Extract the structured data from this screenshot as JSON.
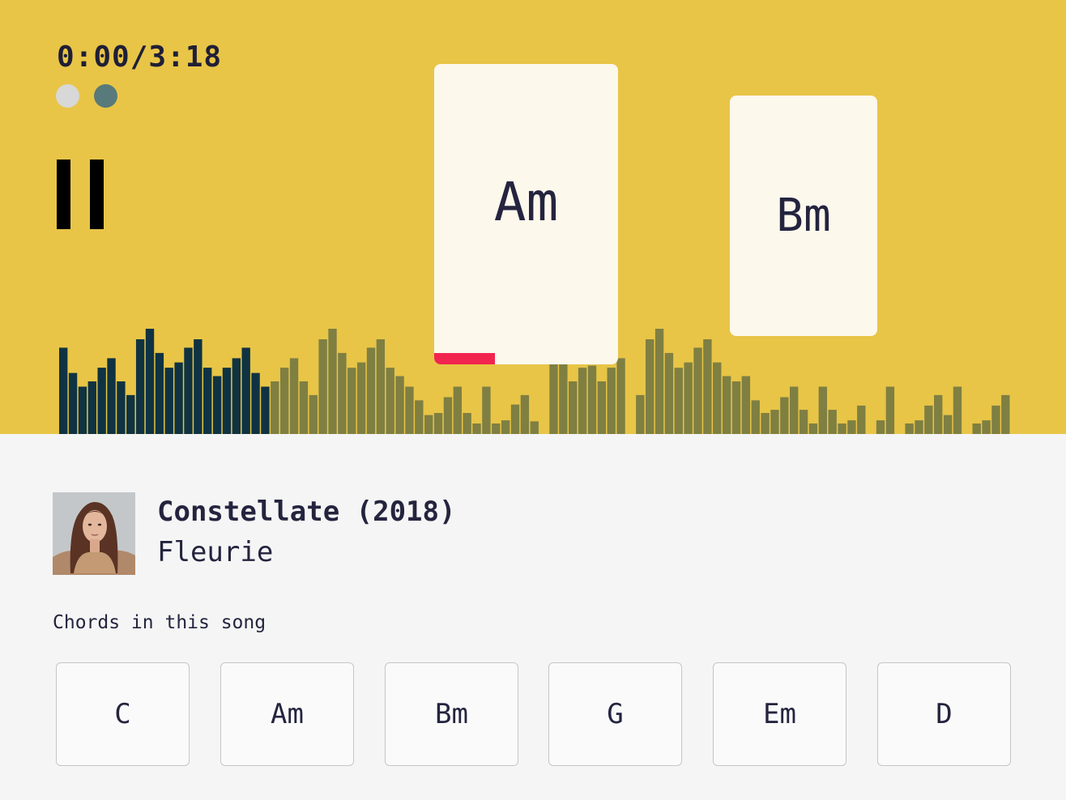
{
  "player": {
    "time": "0:00/3:18",
    "progress_fraction": 0,
    "background_color": "#e8c547",
    "pause_icon": "pause-icon",
    "dots": [
      {
        "name": "dot-inactive",
        "color": "#d8d8d8"
      },
      {
        "name": "dot-active",
        "color": "#587a7a"
      }
    ],
    "current_chord": {
      "label": "Am",
      "progress_fraction": 0.33,
      "progress_color": "#f2254f"
    },
    "next_chord": {
      "label": "Bm"
    },
    "waveform": {
      "played_color": "#0f3342",
      "unplayed_color": "#7f7f42",
      "played_bars": 22,
      "levels": [
        0.82,
        0.58,
        0.45,
        0.5,
        0.63,
        0.72,
        0.5,
        0.37,
        0.9,
        1.0,
        0.77,
        0.63,
        0.68,
        0.82,
        0.9,
        0.63,
        0.55,
        0.63,
        0.72,
        0.82,
        0.58,
        0.45,
        0.5,
        0.63,
        0.72,
        0.5,
        0.37,
        0.9,
        1.0,
        0.77,
        0.63,
        0.68,
        0.82,
        0.9,
        0.63,
        0.55,
        0.45,
        0.32,
        0.18,
        0.2,
        0.35,
        0.45,
        0.2,
        0.1,
        0.45,
        0.1,
        0.13,
        0.28,
        0.37,
        0.12,
        0,
        0.68,
        0.82,
        0.5,
        0.63,
        0.65,
        0.5,
        0.63,
        0.72,
        0,
        0.37,
        0.9,
        1.0,
        0.77,
        0.63,
        0.68,
        0.82,
        0.9,
        0.68,
        0.55,
        0.5,
        0.55,
        0.32,
        0.2,
        0.23,
        0.35,
        0.45,
        0.23,
        0.1,
        0.45,
        0.23,
        0.1,
        0.13,
        0.27,
        0,
        0.13,
        0.45,
        0,
        0.1,
        0.13,
        0.27,
        0.37,
        0.18,
        0.45,
        0,
        0.1,
        0.13,
        0.27,
        0.37
      ]
    }
  },
  "song": {
    "title": "Constellate (2018)",
    "artist": "Fleurie"
  },
  "chords": {
    "heading": "Chords in this song",
    "items": [
      "C",
      "Am",
      "Bm",
      "G",
      "Em",
      "D"
    ]
  }
}
